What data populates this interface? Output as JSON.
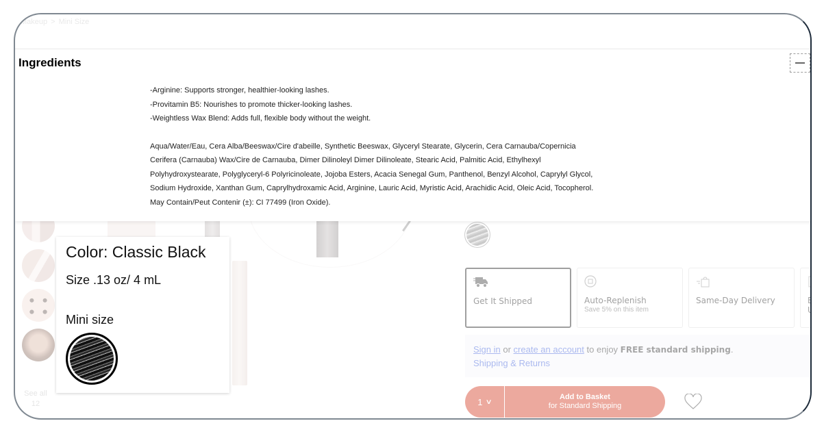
{
  "breadcrumb": {
    "items": [
      "Makeup",
      "Mini Size"
    ],
    "separator": ">"
  },
  "ingredients": {
    "title": "Ingredients",
    "collapse_icon": "minus-icon",
    "highlights": [
      "-Arginine: Supports stronger, healthier-looking lashes.",
      "-Provitamin B5: Nourishes to promote thicker-looking lashes.",
      "-Weightless Wax Blend: Adds full, flexible body without the weight."
    ],
    "list_lines": [
      "Aqua/Water/Eau, Cera Alba/Beeswax/Cire d'abeille, Synthetic Beeswax, Glyceryl Stearate, Glycerin, Cera Carnauba/Copernicia",
      "Cerifera (Carnauba) Wax/Cire de Carnauba, Dimer Dilinoleyl Dimer Dilinoleate, Stearic Acid, Palmitic Acid, Ethylhexyl",
      "Polyhydroxystearate, Polyglyceryl-6 Polyricinoleate, Jojoba Esters, Acacia Senegal Gum, Panthenol, Benzyl Alcohol, Caprylyl Glycol,",
      "Sodium Hydroxide, Xanthan Gum, Caprylhydroxamic Acid, Arginine, Lauric Acid, Myristic Acid, Arachidic Acid, Oleic Acid, Tocopherol.",
      "May Contain/Peut Contenir (±): CI 77499 (Iron Oxide)."
    ]
  },
  "color_popup": {
    "color_label": "Color: Classic Black",
    "size_label": "Size .13 oz/ 4 mL",
    "type_label": "Mini size",
    "swatch_icon": "classic-black-swatch"
  },
  "thumbnails": {
    "count_label_line1": "See all",
    "count_label_line2": "12"
  },
  "shipping_options": [
    {
      "title": "Get It Shipped",
      "subtitle": "",
      "icon": "truck-icon",
      "selected": true
    },
    {
      "title": "Auto-Replenish",
      "subtitle": "Save 5% on this item",
      "icon": "replenish-icon",
      "selected": false
    },
    {
      "title": "Same-Day Delivery",
      "subtitle": "",
      "icon": "delivery-bag-icon",
      "selected": false
    },
    {
      "title": "B",
      "subtitle": "U",
      "icon": "store-icon",
      "selected": false
    }
  ],
  "signin": {
    "signin_link": "Sign in",
    "or_text": " or ",
    "create_link": "create an account",
    "enjoy_text": " to enjoy ",
    "free_text": "FREE standard shipping",
    "period": ".",
    "returns_link": "Shipping & Returns"
  },
  "basket": {
    "quantity": "1",
    "add_label": "Add to Basket",
    "add_sub": "for Standard Shipping",
    "accent_color": "#cf2a0e"
  }
}
